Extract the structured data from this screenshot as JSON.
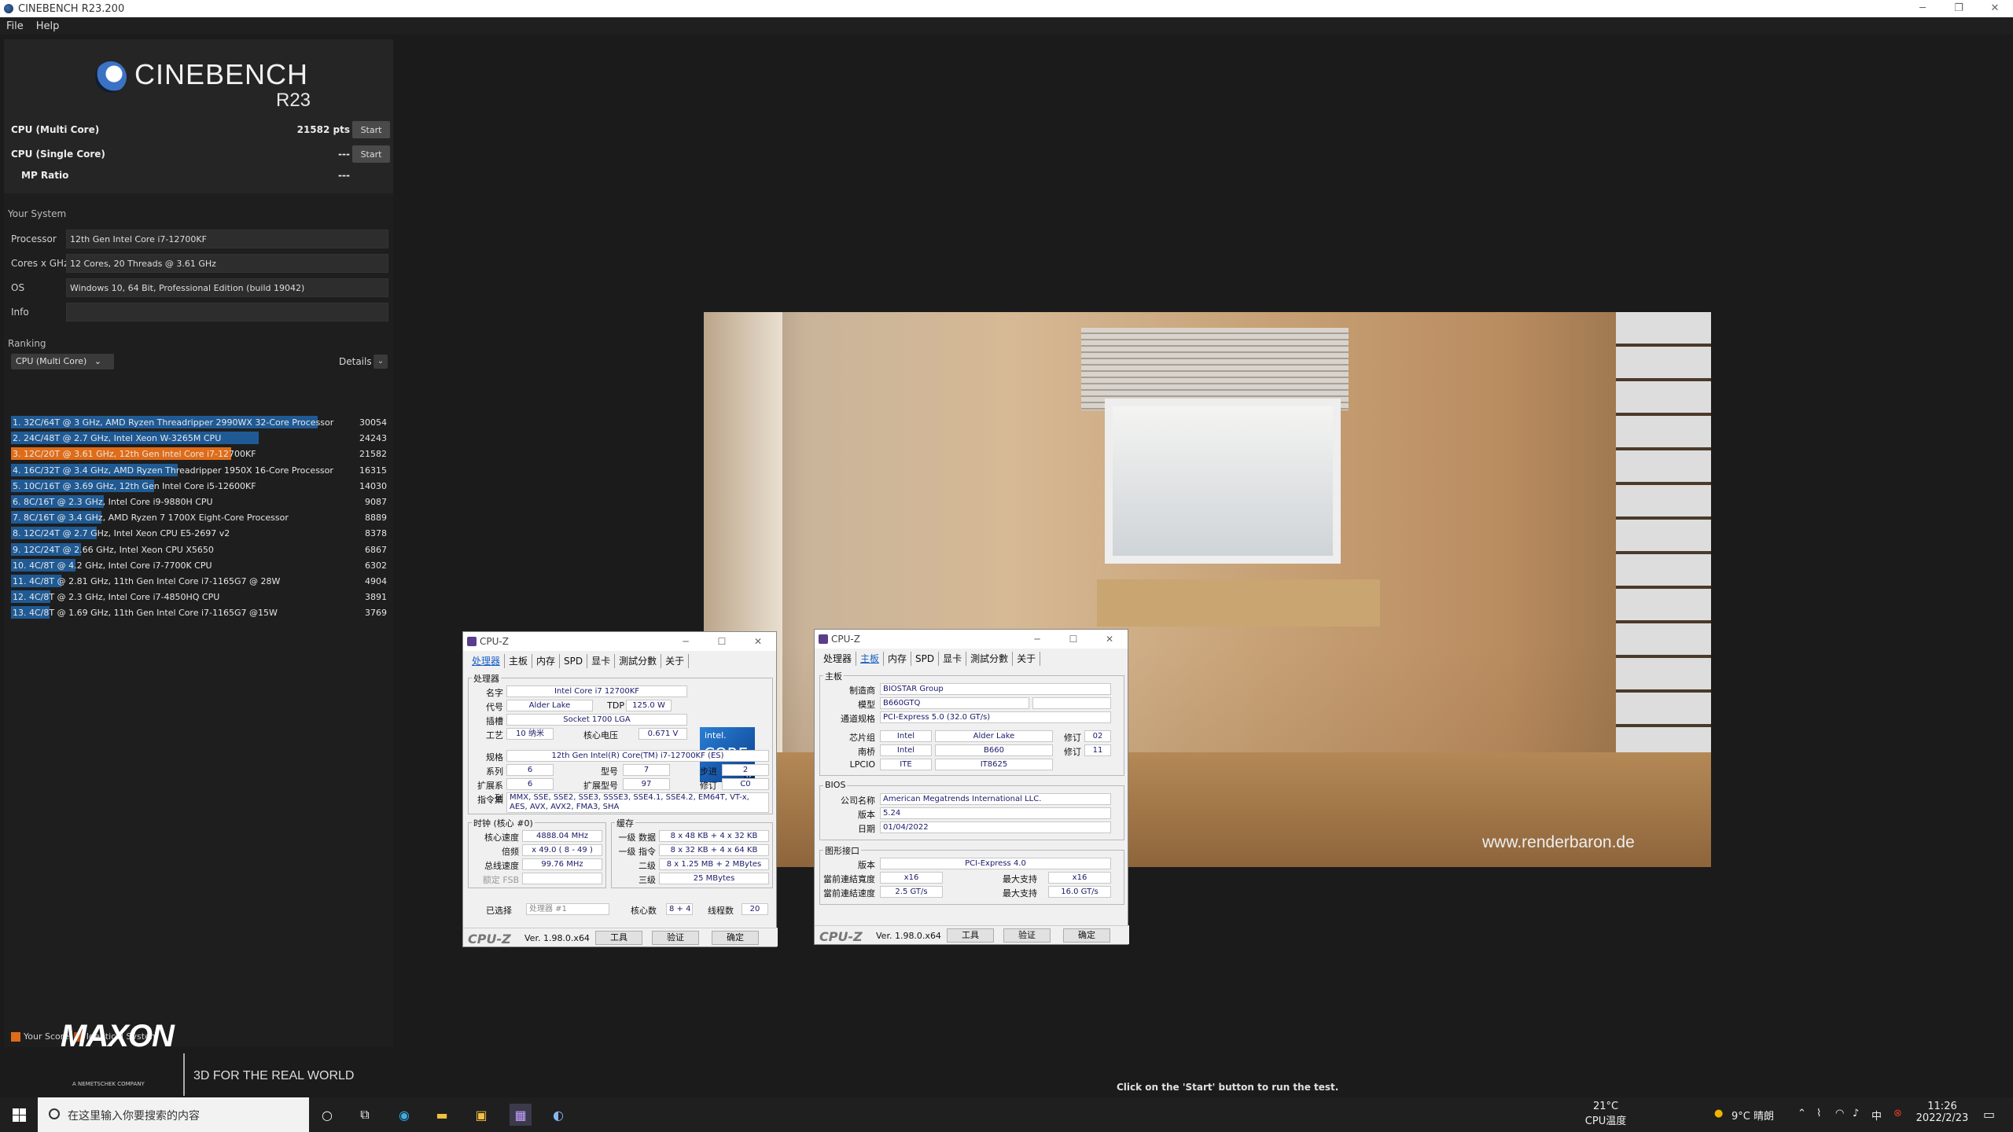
{
  "window": {
    "title": "CINEBENCH R23.200",
    "minimize": "─",
    "restore": "❐",
    "close": "✕"
  },
  "menu": {
    "file": "File",
    "help": "Help"
  },
  "logo": {
    "name": "CINEBENCH",
    "version": "R23"
  },
  "bench": {
    "multi_label": "CPU (Multi Core)",
    "multi_value": "21582 pts",
    "multi_btn": "Start",
    "single_label": "CPU (Single Core)",
    "single_value": "---",
    "single_btn": "Start",
    "mp_label": "MP Ratio",
    "mp_value": "---"
  },
  "system": {
    "title": "Your System",
    "rows": [
      {
        "label": "Processor",
        "value": "12th Gen Intel Core i7-12700KF"
      },
      {
        "label": "Cores x GHz",
        "value": "12 Cores, 20 Threads @ 3.61 GHz"
      },
      {
        "label": "OS",
        "value": "Windows 10, 64 Bit, Professional Edition (build 19042)"
      },
      {
        "label": "Info",
        "value": ""
      }
    ]
  },
  "ranking": {
    "title": "Ranking",
    "select": "CPU (Multi Core)",
    "details": "Details",
    "max": 30054,
    "rows": [
      {
        "text": "1. 32C/64T @ 3 GHz, AMD Ryzen Threadripper 2990WX 32-Core Processor",
        "score": 30054,
        "mine": false
      },
      {
        "text": "2. 24C/48T @ 2.7 GHz, Intel Xeon W-3265M CPU",
        "score": 24243,
        "mine": false
      },
      {
        "text": "3. 12C/20T @ 3.61 GHz, 12th Gen Intel Core i7-12700KF",
        "score": 21582,
        "mine": true
      },
      {
        "text": "4. 16C/32T @ 3.4 GHz, AMD Ryzen Threadripper 1950X 16-Core Processor",
        "score": 16315,
        "mine": false
      },
      {
        "text": "5. 10C/16T @ 3.69 GHz, 12th Gen Intel Core i5-12600KF",
        "score": 14030,
        "mine": false
      },
      {
        "text": "6. 8C/16T @ 2.3 GHz, Intel Core i9-9880H CPU",
        "score": 9087,
        "mine": false
      },
      {
        "text": "7. 8C/16T @ 3.4 GHz, AMD Ryzen 7 1700X Eight-Core Processor",
        "score": 8889,
        "mine": false
      },
      {
        "text": "8. 12C/24T @ 2.7 GHz, Intel Xeon CPU E5-2697 v2",
        "score": 8378,
        "mine": false
      },
      {
        "text": "9. 12C/24T @ 2.66 GHz, Intel Xeon CPU X5650",
        "score": 6867,
        "mine": false
      },
      {
        "text": "10. 4C/8T @ 4.2 GHz, Intel Core i7-7700K CPU",
        "score": 6302,
        "mine": false
      },
      {
        "text": "11. 4C/8T @ 2.81 GHz, 11th Gen Intel Core i7-1165G7 @ 28W",
        "score": 4904,
        "mine": false
      },
      {
        "text": "12. 4C/8T @ 2.3 GHz, Intel Core i7-4850HQ CPU",
        "score": 3891,
        "mine": false
      },
      {
        "text": "13. 4C/8T @ 1.69 GHz, 11th Gen Intel Core i7-1165G7 @15W",
        "score": 3769,
        "mine": false
      }
    ],
    "legend_your": "Your Score",
    "legend_identical": "Identical System",
    "colors": {
      "bar": "#1f5a94",
      "mine": "#e06c18",
      "identical": "#b04a10"
    }
  },
  "maxon": {
    "brand": "MAXON",
    "sub": "A NEMETSCHEK COMPANY",
    "tagline": "3D FOR THE REAL WORLD"
  },
  "hint": "Click on the 'Start' button to run the test.",
  "render": {
    "watermark": "www.renderbaron.de"
  },
  "cpuz1": {
    "title": "CPU-Z",
    "tabs": [
      "处理器",
      "主板",
      "内存",
      "SPD",
      "显卡",
      "測試分數",
      "关于"
    ],
    "group_cpu": "处理器",
    "name_l": "名字",
    "name_v": "Intel Core i7 12700KF",
    "code_l": "代号",
    "code_v": "Alder Lake",
    "tdp_l": "TDP",
    "tdp_v": "125.0 W",
    "socket_l": "插槽",
    "socket_v": "Socket 1700 LGA",
    "tech_l": "工艺",
    "tech_v": "10 纳米",
    "volt_l": "核心电压",
    "volt_v": "0.671 V",
    "spec_l": "规格",
    "spec_v": "12th Gen Intel(R) Core(TM) i7-12700KF (ES)",
    "family_l": "系列",
    "family_v": "6",
    "model_l": "型号",
    "model_v": "7",
    "step_l": "步进",
    "step_v": "2",
    "extfam_l": "扩展系列",
    "extfam_v": "6",
    "extmod_l": "扩展型号",
    "extmod_v": "97",
    "rev_l": "修订",
    "rev_v": "C0",
    "inst_l": "指令集",
    "inst_v": "MMX, SSE, SSE2, SSE3, SSSE3, SSE4.1, SSE4.2, EM64T, VT-x, AES, AVX, AVX2, FMA3, SHA",
    "group_clock": "时钟 (核心 #0)",
    "core_l": "核心速度",
    "core_v": "4888.04 MHz",
    "mult_l": "倍频",
    "mult_v": "x 49.0 ( 8 - 49 )",
    "bus_l": "总线速度",
    "bus_v": "99.76 MHz",
    "fsb_l": "额定 FSB",
    "group_cache": "缓存",
    "l1d_l": "一级 数据",
    "l1d_v": "8 x 48 KB + 4 x 32 KB",
    "l1i_l": "一级 指令",
    "l1i_v": "8 x 32 KB + 4 x 64 KB",
    "l2_l": "二级",
    "l2_v": "8 x 1.25 MB + 2 MBytes",
    "l3_l": "三级",
    "l3_v": "25 MBytes",
    "sel_l": "已选择",
    "sel_v": "处理器 #1",
    "cores_l": "核心数",
    "cores_v": "8 + 4",
    "threads_l": "线程数",
    "threads_v": "20",
    "brand": "CPU-Z",
    "ver": "Ver. 1.98.0.x64",
    "tools": "工具",
    "validate": "验证",
    "ok": "确定",
    "intel_a": "intel.",
    "intel_b": "CORE",
    "intel_c": "i7"
  },
  "cpuz2": {
    "title": "CPU-Z",
    "tabs": [
      "处理器",
      "主板",
      "内存",
      "SPD",
      "显卡",
      "測試分數",
      "关于"
    ],
    "group_mb": "主板",
    "mfr_l": "制造商",
    "mfr_v": "BIOSTAR Group",
    "model_l": "模型",
    "model_v": "B660GTQ",
    "bus_l": "通道规格",
    "bus_v": "PCI-Express 5.0 (32.0 GT/s)",
    "chip_l": "芯片组",
    "chip_v1": "Intel",
    "chip_v2": "Alder Lake",
    "chip_rev_l": "修订",
    "chip_rev_v": "02",
    "south_l": "南桥",
    "south_v1": "Intel",
    "south_v2": "B660",
    "south_rev_l": "修订",
    "south_rev_v": "11",
    "lpcio_l": "LPCIO",
    "lpcio_v1": "ITE",
    "lpcio_v2": "IT8625",
    "group_bios": "BIOS",
    "brand_l": "公司名称",
    "brand_v": "American Megatrends International LLC.",
    "ver_l": "版本",
    "ver_v": "5.24",
    "date_l": "日期",
    "date_v": "01/04/2022",
    "group_gfx": "图形接口",
    "gver_l": "版本",
    "gver_v": "PCI-Express 4.0",
    "link_l": "當前連結寬度",
    "link_v": "x16",
    "max_l": "最大支持",
    "max_v": "x16",
    "speed_l": "當前連結速度",
    "speed_v": "2.5 GT/s",
    "maxs_l": "最大支持",
    "maxs_v": "16.0 GT/s",
    "brand": "CPU-Z",
    "ver": "Ver. 1.98.0.x64",
    "tools": "工具",
    "validate": "验证",
    "ok": "确定"
  },
  "taskbar": {
    "search_placeholder": "在这里输入你要搜索的内容",
    "temp": "21°C",
    "temp_label": "CPU温度",
    "weather": "9°C 晴朗",
    "ime": "中",
    "time": "11:26",
    "date": "2022/2/23"
  }
}
